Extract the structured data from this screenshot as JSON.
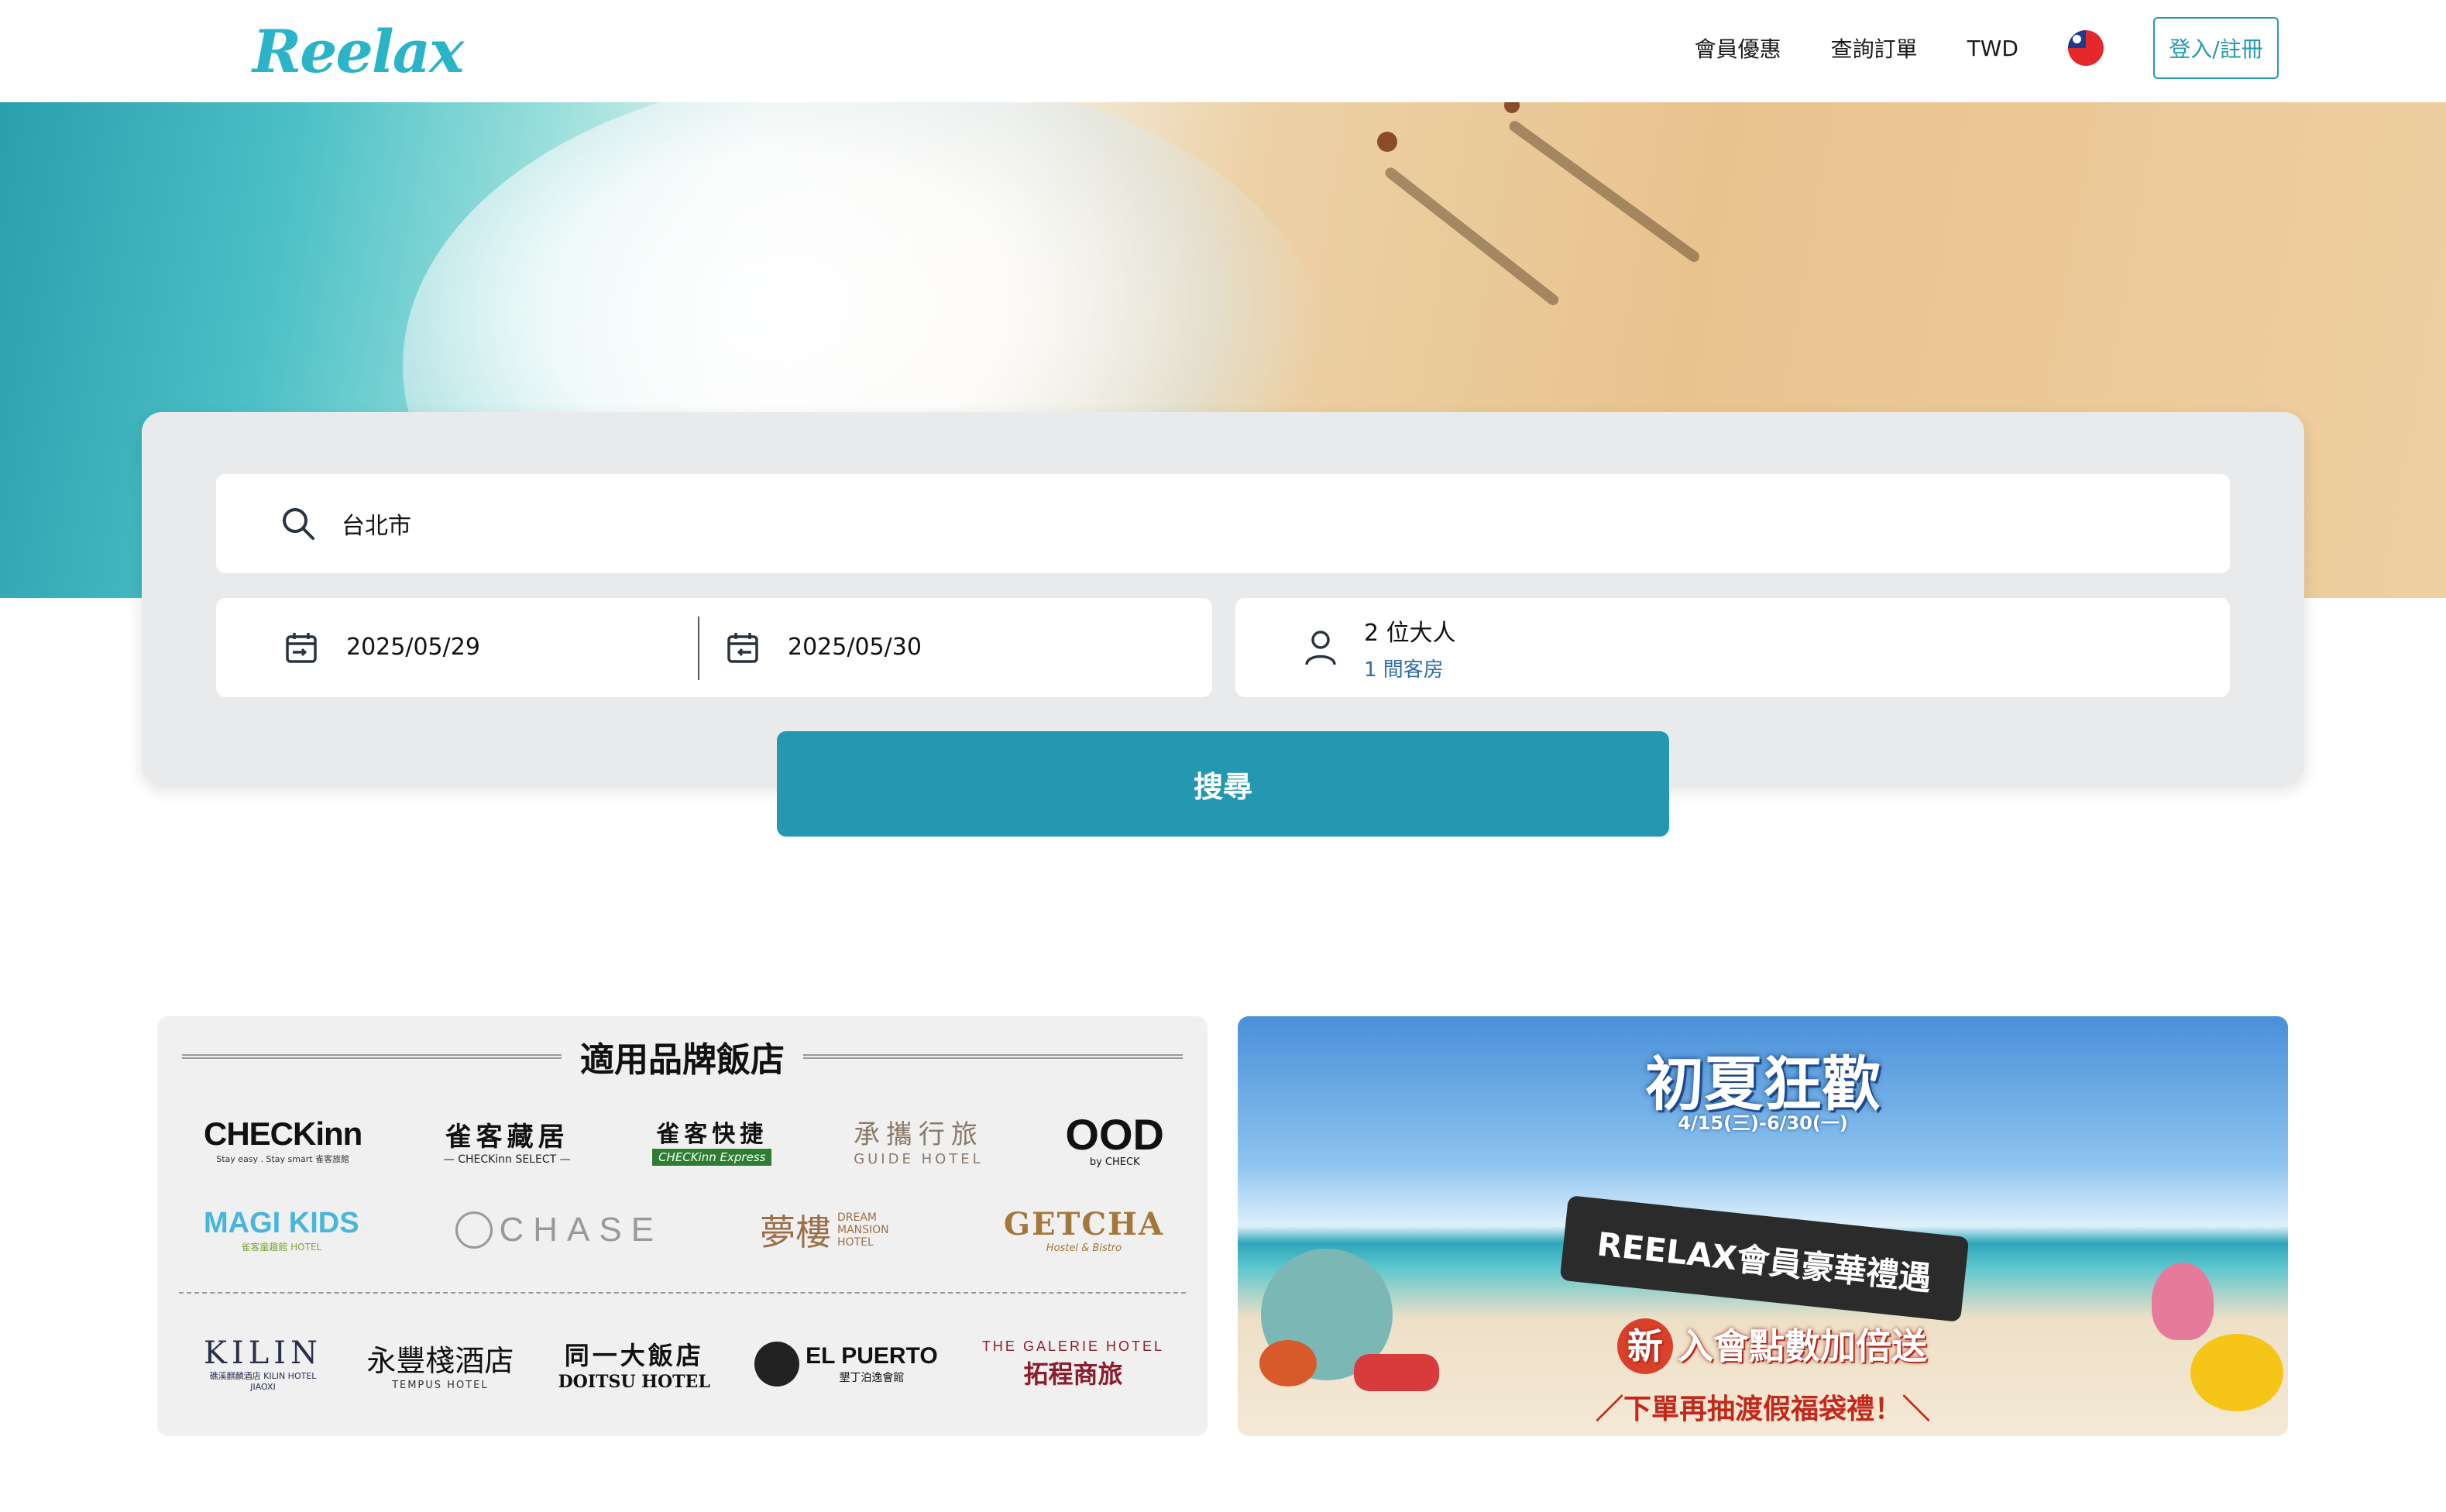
{
  "header": {
    "logo": "Reelax",
    "nav": {
      "member_offers": "會員優惠",
      "check_order": "查詢訂單",
      "currency": "TWD",
      "login": "登入/註冊"
    }
  },
  "search": {
    "destination": "台北市",
    "checkin": "2025/05/29",
    "checkout": "2025/05/30",
    "guests": "2 位大人",
    "rooms": "1 間客房",
    "button": "搜尋"
  },
  "brands": {
    "title": "適用品牌飯店",
    "items": {
      "checkinn": "CHECKinn",
      "checkinn_sub": "Stay easy . Stay smart 雀客旅館",
      "select": "雀客藏居",
      "select_sub": "— CHECKinn SELECT —",
      "express": "雀客快捷",
      "express_sub": "CHECKinn Express",
      "guide": "承攜行旅",
      "guide_sub": "GUIDE HOTEL",
      "ood": "OOD",
      "ood_sub": "by CHECK",
      "magikids": "MAGI KIDS",
      "magikids_sub": "雀客童趣館 HOTEL",
      "chase": "CHASE",
      "dream": "夢樓",
      "dream_sub": "DREAM MANSION HOTEL",
      "getcha": "GETCHA",
      "getcha_sub": "Hostel & Bistro",
      "kilin": "KILIN",
      "kilin_sub": "礁溪麒麟酒店 KILIN HOTEL JIAOXI",
      "tempus": "永豐棧酒店",
      "tempus_sub": "TEMPUS HOTEL",
      "doitsu": "同一大飯店",
      "doitsu_sub": "DOITSU HOTEL",
      "elpuerto": "EL PUERTO",
      "elpuerto_sub": "墾丁泊逸會館",
      "galerie": "THE GALERIE HOTEL",
      "galerie_sub": "拓程商旅"
    }
  },
  "promo": {
    "title": "初夏狂歡",
    "date": "4/15(三)-6/30(一)",
    "ribbon": "REELAX會員豪華禮遇",
    "new_badge": "新",
    "new_text": "入會點數加倍送",
    "bottom": "／下單再抽渡假福袋禮！＼"
  },
  "colors": {
    "brand_teal": "#2bb3c7",
    "button_teal": "#2398b0",
    "login_border": "#2699b0",
    "rooms_text": "#2d6ea8"
  }
}
